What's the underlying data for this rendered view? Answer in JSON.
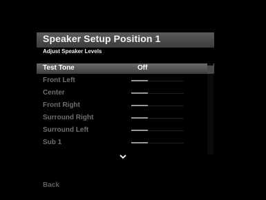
{
  "header": {
    "title": "Speaker Setup Position 1",
    "subtitle": "Adjust Speaker Levels"
  },
  "menu": {
    "items": [
      {
        "label": "Test Tone",
        "value": "Off",
        "selected": true
      },
      {
        "label": "Front Left",
        "level": 0.32
      },
      {
        "label": "Center",
        "level": 0.32
      },
      {
        "label": "Front Right",
        "level": 0.32
      },
      {
        "label": "Surround Right",
        "level": 0.32
      },
      {
        "label": "Surround Left",
        "level": 0.32
      },
      {
        "label": "Sub 1",
        "level": 0.32
      }
    ],
    "more_icon": "chevron-down-icon"
  },
  "footer": {
    "back_label": "Back"
  }
}
